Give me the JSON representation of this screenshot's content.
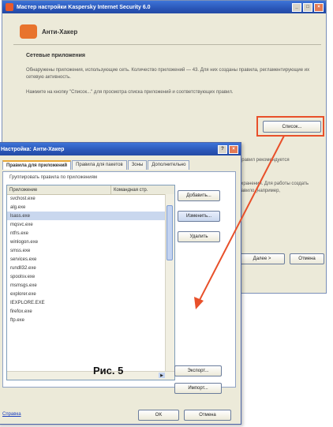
{
  "back_window": {
    "title": "Мастер настройки Kaspersky Internet Security 6.0",
    "header": "Анти-Хакер",
    "section_title": "Сетевые приложения",
    "paragraph1": "Обнаружены приложения, использующие сеть. Количество приложений — 43. Для них созданы правила, регламентирующие их сетевую активность.",
    "paragraph2": "Нажмите на кнопку \"Список...\" для просмотра списка приложений и соответствующих правил.",
    "list_button": "Список...",
    "next_button": "Далее >",
    "cancel_button": "Отмена",
    "side_text1": "правил рекомендуется",
    "side_text2": "сохранения. Для работы создать правило (например,"
  },
  "front_window": {
    "title": "Настройка: Анти-Хакер",
    "tabs": [
      "Правила для приложений",
      "Правила для пакетов",
      "Зоны",
      "Дополнительно"
    ],
    "caption": "Группировать правила по приложениям",
    "columns": [
      "Приложение",
      "Командная стр."
    ],
    "rows": [
      "svchost.exe",
      "alg.exe",
      "lsass.exe",
      "mqsvc.exe",
      "ntfrs.exe",
      "winlogon.exe",
      "smss.exe",
      "services.exe",
      "rundll32.exe",
      "spoolsv.exe",
      "msmsgs.exe",
      "explorer.exe",
      "IEXPLORE.EXE",
      "firefox.exe",
      "ftp.exe"
    ],
    "selected_row": 2,
    "add_button": "Добавить...",
    "apply_button": "Изменить...",
    "delete_button": "Удалить",
    "export_button": "Экспорт...",
    "import_button": "Импорт...",
    "ok_button": "OK",
    "cancel_button": "Отмена",
    "help_link": "Справка"
  },
  "figure_caption": "Рис. 5",
  "colors": {
    "highlight": "#e8502a",
    "titlebar": "#2a56b8",
    "selection": "#c9d7ee"
  }
}
